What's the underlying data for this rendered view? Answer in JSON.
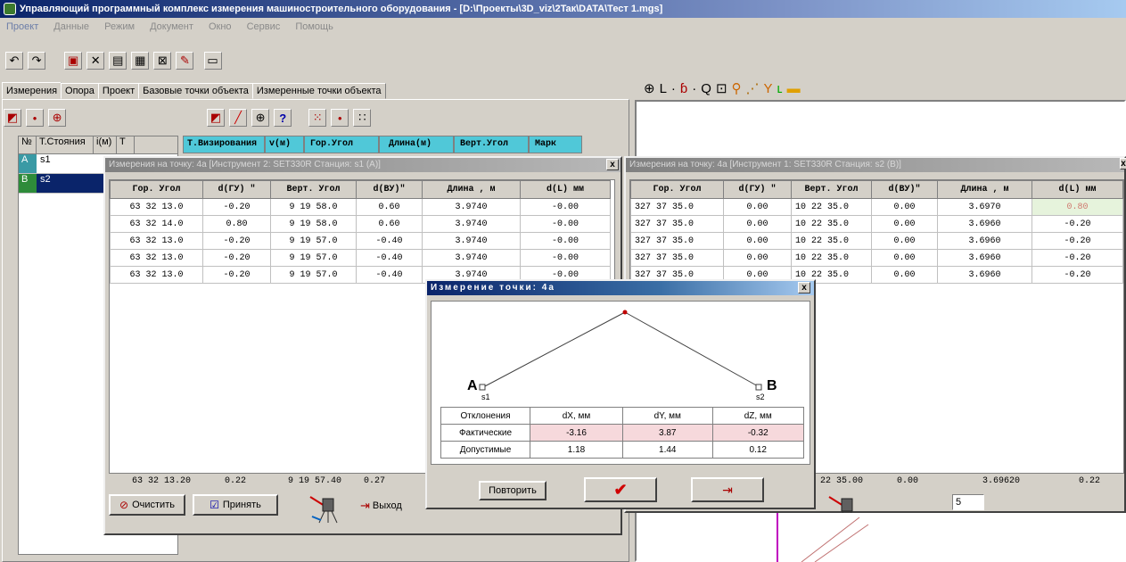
{
  "app": {
    "title": "Управляющий программный комплекс измерения машиностроительного оборудования - [D:\\Проекты\\3D_viz\\2Taк\\DATA\\Тест 1.mgs]"
  },
  "menu": [
    "Проект",
    "Данные",
    "Режим",
    "Документ",
    "Окно",
    "Сервис",
    "Помощь"
  ],
  "tabs": [
    "Измерения",
    "Опора",
    "Проект",
    "Базовые точки объекта",
    "Измеренные точки объекта"
  ],
  "stations_header": [
    "№",
    "Т.Стояния",
    "i(м)",
    "T"
  ],
  "stations": [
    {
      "code": "A",
      "color": "#3a9aa5",
      "name": "s1"
    },
    {
      "code": "B",
      "color": "#2e8b3a",
      "name": "s2"
    }
  ],
  "main_header": [
    "Т.Визирования",
    "v(м)",
    "Гор.Угол",
    "Длина(м)",
    "Верт.Угол",
    "Марк"
  ],
  "left_win": {
    "title": "Измерения на точку: 4а   [Инструмент 2: SET330R  Станция: s1 (A)]",
    "close": "x",
    "headers": [
      "Гор. Угол",
      "d(ГУ) \"",
      "Верт. Угол",
      "d(ВУ)\"",
      "Длина , м",
      "d(L) мм"
    ],
    "rows": [
      [
        "63 32  13.0",
        "-0.20",
        "9 19  58.0",
        "0.60",
        "3.9740",
        "-0.00"
      ],
      [
        "63 32  14.0",
        "0.80",
        "9 19  58.0",
        "0.60",
        "3.9740",
        "-0.00"
      ],
      [
        "63 32  13.0",
        "-0.20",
        "9 19  57.0",
        "-0.40",
        "3.9740",
        "-0.00"
      ],
      [
        "63 32  13.0",
        "-0.20",
        "9 19  57.0",
        "-0.40",
        "3.9740",
        "-0.00"
      ],
      [
        "63 32  13.0",
        "-0.20",
        "9 19  57.0",
        "-0.40",
        "3.9740",
        "-0.00"
      ]
    ],
    "summary": [
      "63 32 13.20",
      "0.22",
      "9 19 57.40",
      "0.27"
    ],
    "buttons": {
      "clear": "Очистить",
      "accept": "Принять",
      "exit": "Выход"
    }
  },
  "right_win": {
    "title": "Измерения на точку: 4а   [Инструмент 1: SET330R  Станция: s2 (B)]",
    "close": "x",
    "headers": [
      "Гор. Угол",
      "d(ГУ) \"",
      "Верт. Угол",
      "d(ВУ)\"",
      "Длина , м",
      "d(L) мм"
    ],
    "rows": [
      [
        "327 37  35.0",
        "0.00",
        "10 22  35.0",
        "0.00",
        "3.6970",
        "0.80"
      ],
      [
        "327 37  35.0",
        "0.00",
        "10 22  35.0",
        "0.00",
        "3.6960",
        "-0.20"
      ],
      [
        "327 37  35.0",
        "0.00",
        "10 22  35.0",
        "0.00",
        "3.6960",
        "-0.20"
      ],
      [
        "327 37  35.0",
        "0.00",
        "10 22  35.0",
        "0.00",
        "3.6960",
        "-0.20"
      ],
      [
        "327 37  35.0",
        "0.00",
        "10 22  35.0",
        "0.00",
        "3.6960",
        "-0.20"
      ]
    ],
    "summary": [
      "0 22 35.00",
      "0.00",
      "3.69620",
      "0.22"
    ],
    "counter": "5"
  },
  "dialog": {
    "title": "Измерение точки: 4а",
    "close": "x",
    "point_a": "A",
    "label_a": "s1",
    "point_b": "B",
    "label_b": "s2",
    "table_headers": [
      "Отклонения",
      "dX, мм",
      "dY, мм",
      "dZ, мм"
    ],
    "actual": {
      "label": "Фактические",
      "values": [
        "-3.16",
        "3.87",
        "-0.32"
      ]
    },
    "allowed": {
      "label": "Допустимые",
      "values": [
        "1.18",
        "1.44",
        "0.12"
      ]
    },
    "repeat": "Повторить",
    "ok_icon": "✔",
    "exit_icon": "exit-icon"
  },
  "right_toolbar_icons": [
    "⊕",
    "L",
    "·",
    "ɓ",
    "·",
    "Q",
    "⊡",
    "⚲",
    "⋰",
    "Y",
    "ʟ",
    "▬"
  ]
}
